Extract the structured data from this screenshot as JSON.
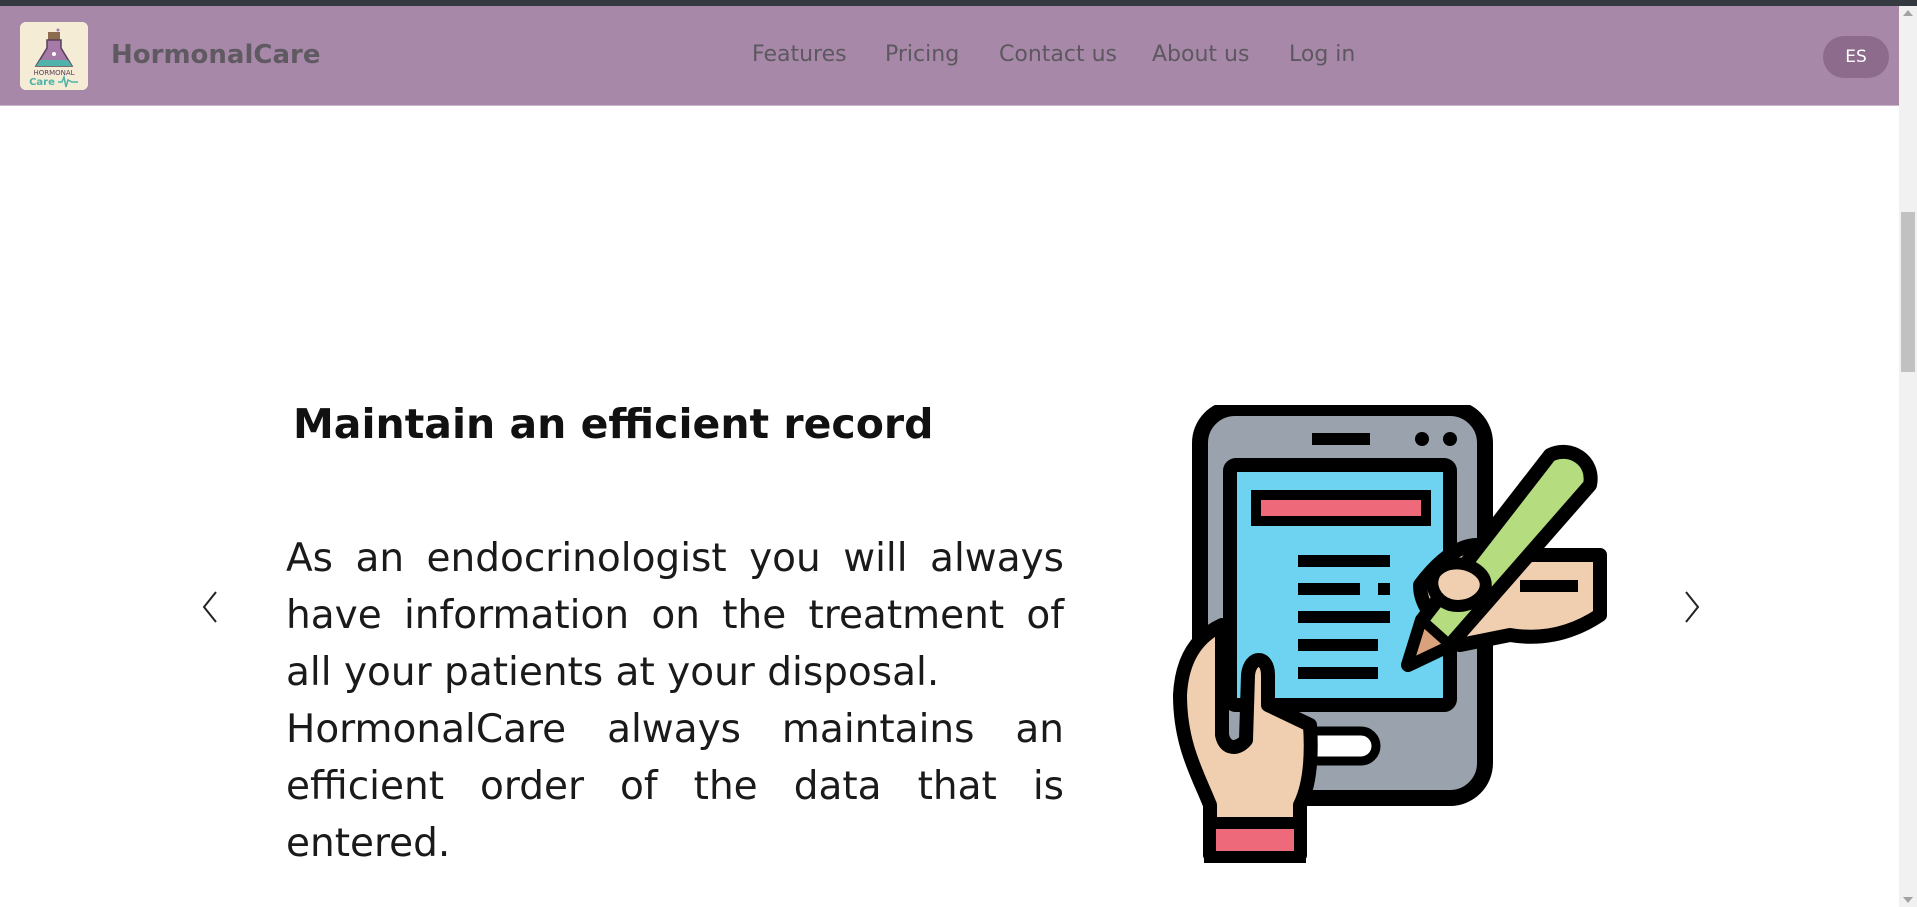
{
  "navbar": {
    "brand": "HormonalCare",
    "logo_icon": "hormonalcare-logo-icon",
    "logo_text_line1": "HORMONAL",
    "logo_text_line2": "Care",
    "links": [
      "Features",
      "Pricing",
      "Contact us",
      "About us",
      "Log in"
    ],
    "language_button": "ES"
  },
  "slide": {
    "heading": "Maintain an efficient record",
    "paragraph1": "As an endocrinologist you will always have information on the treatment of all your patients at your disposal.",
    "paragraph2": "HormonalCare always maintains an efficient order of the data that is entered.",
    "illustration_icon": "tablet-with-pen-icon",
    "prev_icon": "chevron-left-icon",
    "next_icon": "chevron-right-icon"
  },
  "colors": {
    "navbar_bg": "#a888a8",
    "brand_text": "#5f5a62",
    "language_button_bg": "#8d6b8d",
    "tablet_screen": "#6dd3f0",
    "tablet_body": "#9aa2ad",
    "pen_green": "#b5dc7f",
    "skin": "#f0cfb0",
    "accent_red": "#ee6a7b"
  }
}
